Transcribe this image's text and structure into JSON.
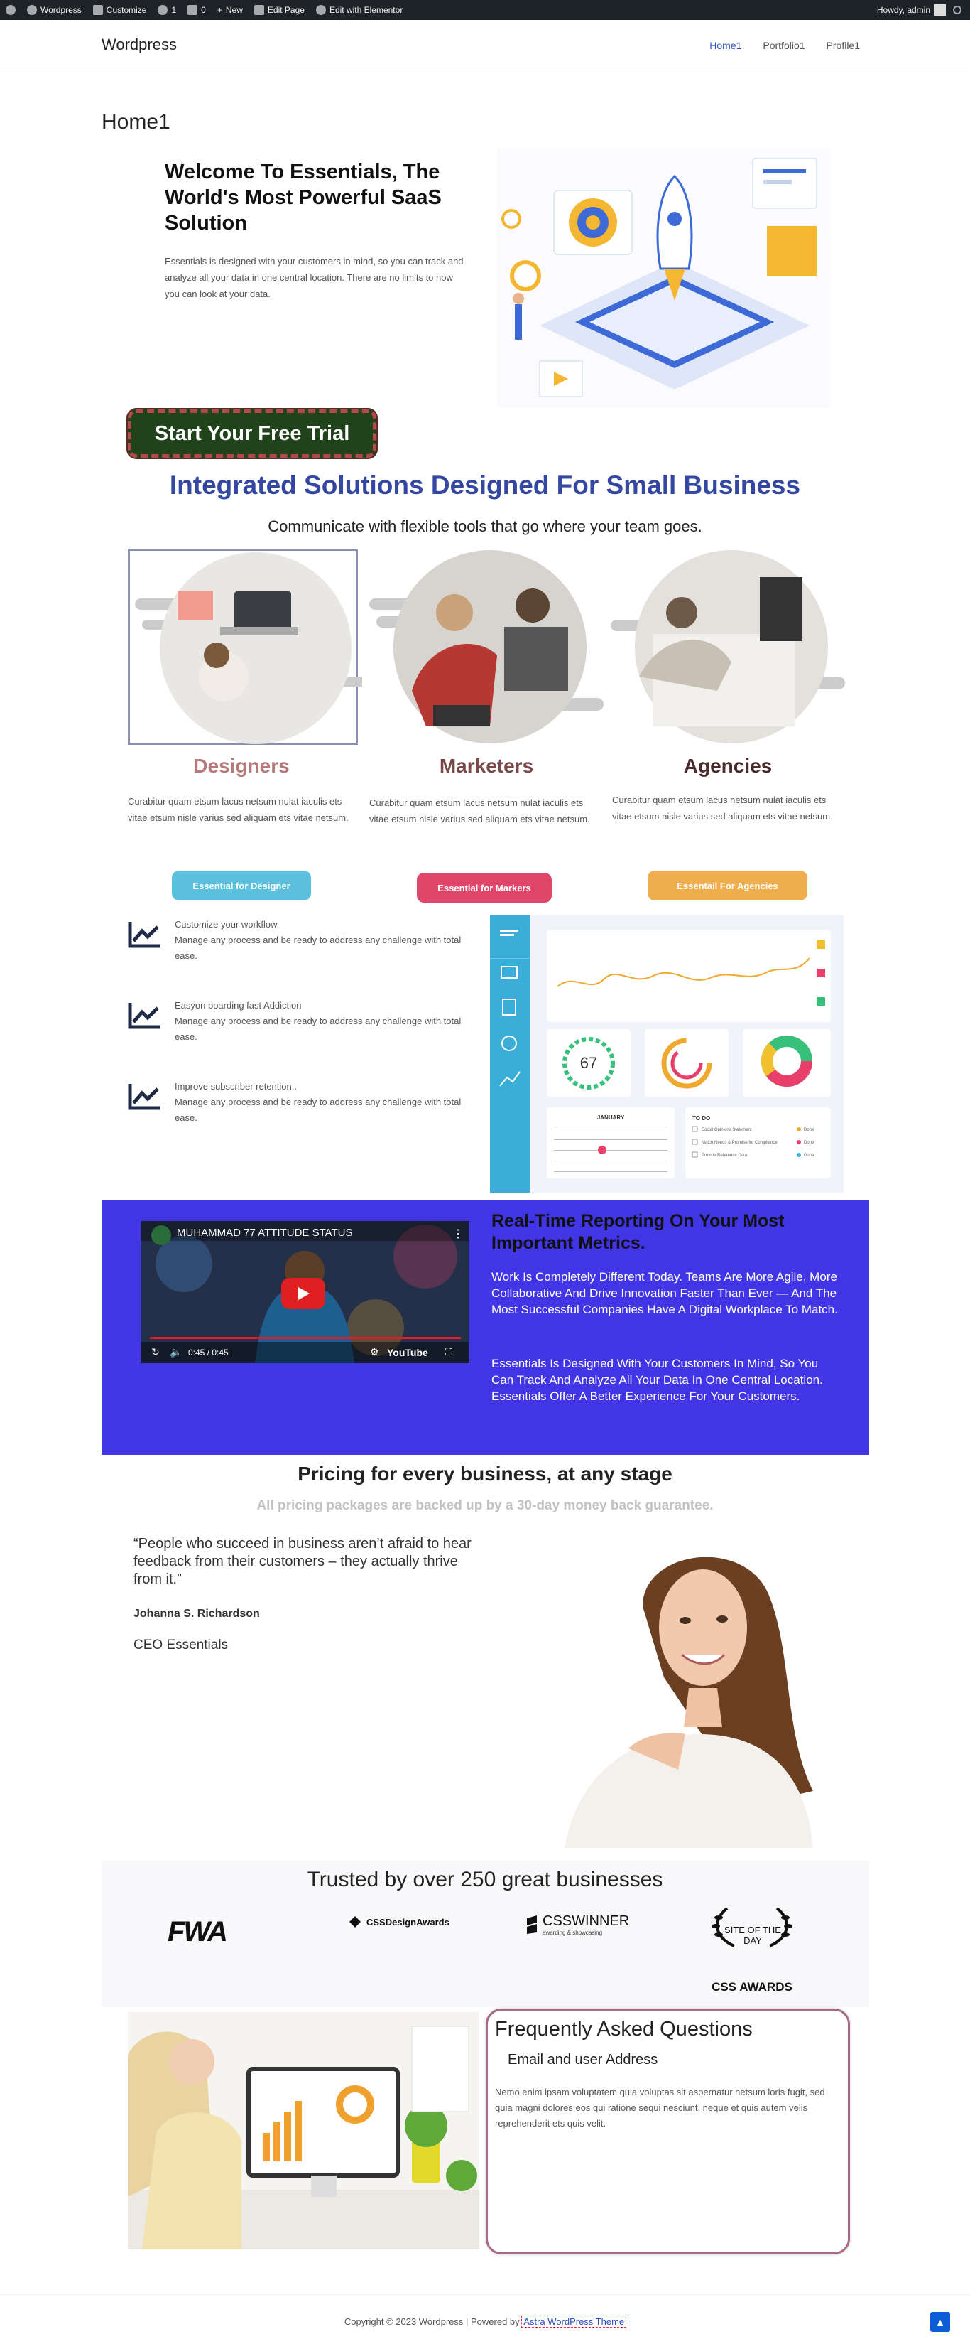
{
  "admin_bar": {
    "site": "Wordpress",
    "customize": "Customize",
    "updates": "1",
    "comments": "0",
    "new": "New",
    "edit_page": "Edit Page",
    "edit_elementor": "Edit with Elementor",
    "howdy": "Howdy, admin"
  },
  "header": {
    "site_title": "Wordpress",
    "nav": [
      "Home1",
      "Portfolio1",
      "Profile1"
    ]
  },
  "page_title": "Home1",
  "hero": {
    "title": "Welcome To Essentials, The World's Most Powerful SaaS Solution",
    "text": "Essentials is designed with your customers in mind, so you can track and analyze all your data in one central location. There are no limits to how you can look at your data.",
    "cta": "Start Your Free Trial"
  },
  "integrated": {
    "title": "Integrated Solutions Designed For Small Business",
    "subtitle": "Communicate with flexible tools that go where your team goes.",
    "cards": [
      {
        "title": "Designers",
        "text": "Curabitur quam etsum lacus netsum nulat iaculis ets vitae etsum nisle varius sed aliquam ets vitae netsum.",
        "button": "Essential for Designer",
        "color": "#5bc0de"
      },
      {
        "title": "Marketers",
        "text": "Curabitur quam etsum lacus netsum nulat iaculis ets vitae etsum nisle varius sed aliquam ets vitae netsum.",
        "button": "Essential for Markers",
        "color": "#e8406b"
      },
      {
        "title": "Agencies",
        "text": "Curabitur quam etsum lacus netsum nulat iaculis ets vitae etsum nisle varius sed aliquam ets vitae netsum.",
        "button": "Essentail For Agencies",
        "color": "#f0ad4e"
      }
    ]
  },
  "features": [
    {
      "title": "Customize your workflow.",
      "text": "Manage any process and be ready to address any challenge with total ease."
    },
    {
      "title": "Easyon boarding fast Addiction",
      "text": "Manage any process and be ready to address any challenge with total ease."
    },
    {
      "title": "Improve subscriber retention..",
      "text": "Manage any process and be ready to address any challenge with total ease."
    }
  ],
  "dashboard": {
    "gauge_value": "67",
    "calendar_month": "JANUARY",
    "todo_title": "TO DO",
    "todo": [
      {
        "task": "Social Opinions Statement",
        "status": "Done"
      },
      {
        "task": "Match Needs & Promise for Compliance",
        "status": "Done"
      },
      {
        "task": "Provide Reference Data",
        "status": "Done"
      }
    ]
  },
  "video": {
    "title": "MUHAMMAD 77 ATTITUDE STATUS",
    "time": "0:45 / 0:45",
    "brand": "YouTube"
  },
  "realtime": {
    "title": "Real-Time Reporting On Your Most Important Metrics.",
    "p1": "Work Is Completely Different Today. Teams Are More Agile, More Collaborative And Drive Innovation Faster Than Ever — And The Most Successful Companies Have A Digital Workplace To Match.",
    "p2": "Essentials Is Designed With Your Customers In Mind, So You Can Track And Analyze All Your Data In One Central Location. Essentials Offer A Better Experience For Your Customers."
  },
  "pricing": {
    "title": "Pricing for every business, at any stage",
    "subtitle": "All pricing packages are backed up by a 30-day money back guarantee."
  },
  "testimonial": {
    "quote": "“People who succeed in business aren’t afraid to hear feedback from their customers – they actually thrive from it.”",
    "name": "Johanna S. Richardson",
    "role": "CEO Essentials"
  },
  "trusted": {
    "title": "Trusted by over 250 great businesses",
    "logos": [
      "FWA",
      "CSSDesignAwards",
      "CSSWINNER",
      "awarding & showcasing",
      "SITE OF THE DAY",
      "CSS AWARDS"
    ]
  },
  "faq": {
    "title": "Frequently Asked Questions",
    "question": "Email and user Address",
    "answer": "Nemo enim ipsam voluptatem quia voluptas sit aspernatur netsum loris fugit, sed quia magni dolores eos qui ratione sequi nesciunt. neque et quis autem velis reprehenderit ets quis velit."
  },
  "footer": {
    "copyright": "Copyright © 2023 Wordpress | Powered by",
    "theme_link": "Astra WordPress Theme"
  }
}
